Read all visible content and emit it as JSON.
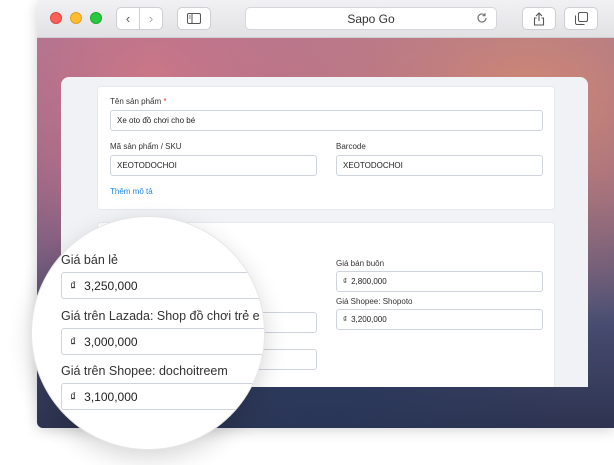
{
  "browser": {
    "title": "Sapo Go",
    "back_glyph": "‹",
    "forward_glyph": "›",
    "icons": [
      "back-icon",
      "forward-icon",
      "sidebar-icon",
      "reload-icon",
      "share-icon",
      "tabs-icon"
    ]
  },
  "product": {
    "name_label": "Tên sản phẩm",
    "required_mark": "*",
    "name_value": "Xe oto đồ chơi cho bé",
    "sku_label": "Mã sản phẩm / SKU",
    "sku_value": "XEOTODOCHOI",
    "barcode_label": "Barcode",
    "barcode_value": "XEOTODOCHOI",
    "add_description": "Thêm mô tả"
  },
  "pricing": {
    "wholesale_label": "Giá bán buôn",
    "wholesale_value": "2,800,000",
    "shopee_shopoto_label": "Giá Shopee: Shopoto",
    "shopee_shopoto_value": "3,200,000",
    "retail_label": "Giá bán lẻ",
    "retail_value": "3,250,000",
    "lazada_label": "Giá trên Lazada: Shop đồ chơi trẻ e",
    "lazada_value": "3,000,000",
    "shopee_dochoi_label": "Giá trên Shopee: dochoitreem",
    "shopee_dochoi_value": "3,100,000",
    "currency": "₫"
  },
  "colors": {
    "link": "#1e88e5",
    "required": "#e53935"
  }
}
